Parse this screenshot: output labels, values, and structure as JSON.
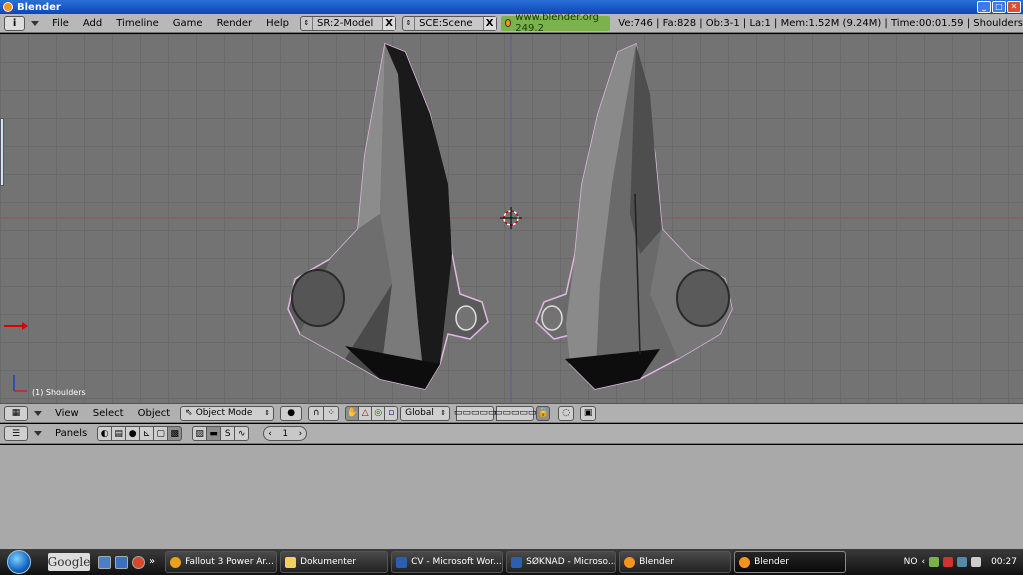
{
  "window": {
    "title": "Blender"
  },
  "top_header": {
    "info_icon": "i",
    "menus": [
      "File",
      "Add",
      "Timeline",
      "Game",
      "Render",
      "Help"
    ],
    "screen_field": "SR:2-Model",
    "scene_field": "SCE:Scene",
    "url": "www.blender.org 249.2",
    "stats": "Ve:746 | Fa:828 | Ob:3-1 | La:1 | Mem:1.52M (9.24M) | Time:00:01.59 | Shoulders"
  },
  "viewport": {
    "object_label": "(1) Shoulders"
  },
  "view_header": {
    "menus": [
      "View",
      "Select",
      "Object"
    ],
    "mode": "Object Mode",
    "orientation": "Global"
  },
  "buttons_header": {
    "panels_label": "Panels",
    "frame_value": "1"
  },
  "taskbar": {
    "search_label": "Google",
    "tasks": [
      {
        "label": "Fallout 3 Power Ar...",
        "color": "#e8a317"
      },
      {
        "label": "Dokumenter",
        "color": "#f0d060"
      },
      {
        "label": "CV - Microsoft Wor...",
        "color": "#2b5fb4"
      },
      {
        "label": "SØKNAD - Microso...",
        "color": "#2b5fb4"
      },
      {
        "label": "Blender",
        "color": "#f7931e"
      },
      {
        "label": "Blender",
        "color": "#f7931e"
      }
    ],
    "lang": "NO",
    "clock": "00:27"
  }
}
